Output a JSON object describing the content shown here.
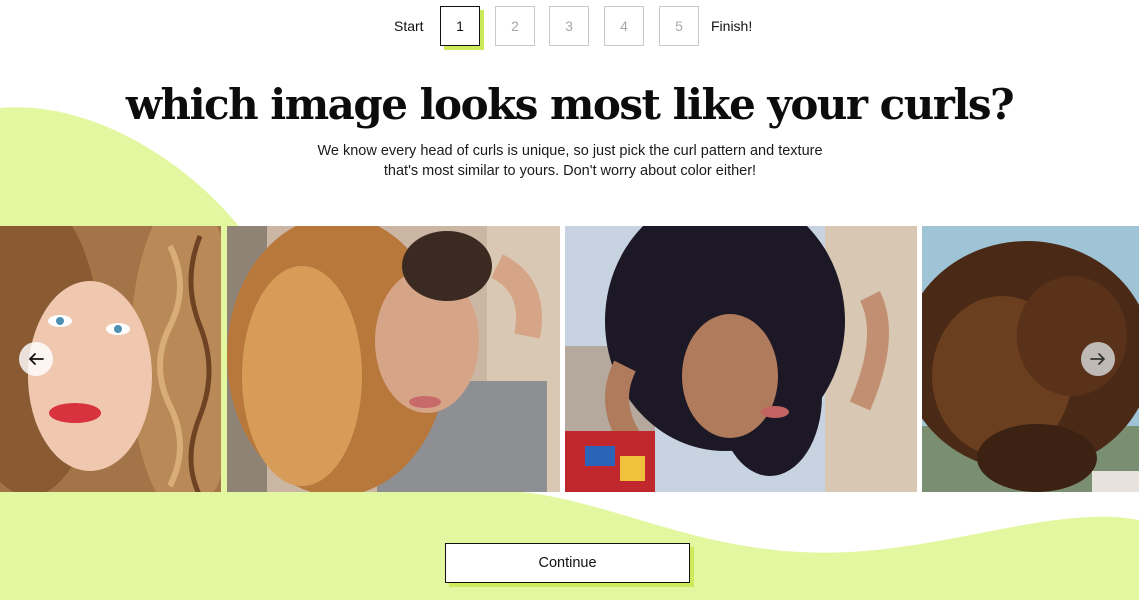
{
  "stepper": {
    "start_label": "Start",
    "finish_label": "Finish!",
    "steps": [
      "1",
      "2",
      "3",
      "4",
      "5"
    ],
    "active_step": "1"
  },
  "question": {
    "title": "which image looks most like your curls?",
    "subtitle": "We know every head of curls is unique, so just pick the curl pattern and texture that's most similar to yours. Don't worry about color either!"
  },
  "carousel": {
    "prev_icon": "arrow-left-icon",
    "next_icon": "arrow-right-icon"
  },
  "actions": {
    "continue_label": "Continue"
  },
  "colors": {
    "accent": "#cdea5a",
    "blob": "#e3f7a0"
  }
}
